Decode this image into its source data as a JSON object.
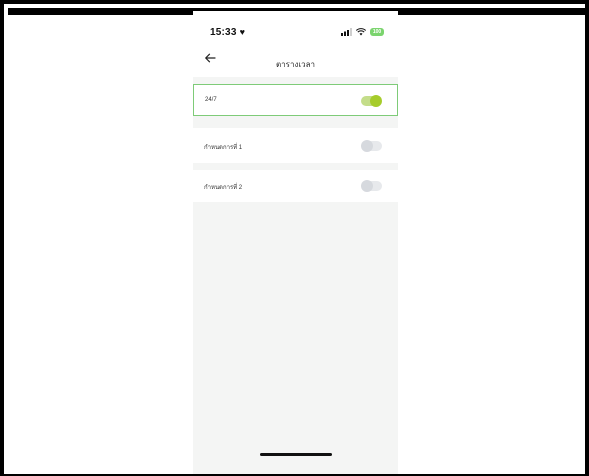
{
  "status_bar": {
    "time": "15:33",
    "time_suffix_icon": "heart-icon",
    "signal_icon": "cellular-signal-icon",
    "wifi_icon": "wifi-icon",
    "battery_label": "100",
    "battery_color": "#7bd46e"
  },
  "header": {
    "back_icon": "arrow-left-icon",
    "title": "ตารางเวลา"
  },
  "schedules": [
    {
      "label": "24/7",
      "enabled": true,
      "selected": true
    },
    {
      "label": "กำหนดการที่ 1",
      "enabled": false,
      "selected": false
    },
    {
      "label": "กำหนดการที่ 2",
      "enabled": false,
      "selected": false
    }
  ],
  "colors": {
    "accent": "#a6cc2b",
    "selected_border": "#7ecb78",
    "background": "#f4f5f4"
  }
}
